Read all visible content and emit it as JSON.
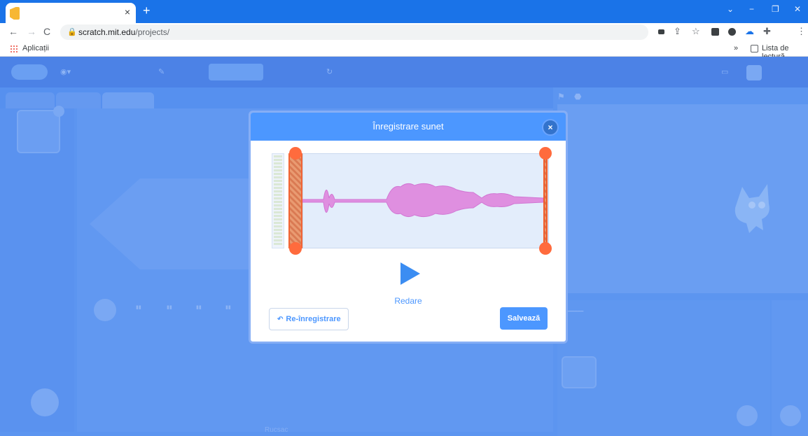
{
  "browser": {
    "tab_close": "×",
    "new_tab": "+",
    "window_controls": {
      "minimize": "−",
      "restore": "❐",
      "close": "✕",
      "chevron": "⌄"
    },
    "nav": {
      "back": "←",
      "forward": "→",
      "reload": "C"
    },
    "url_host": "scratch.mit.edu",
    "url_path": "/projects/",
    "bookmarks": {
      "apps_label": "Aplicații",
      "overflow": "»",
      "reading_list": "Lista de lectură"
    }
  },
  "modal": {
    "title": "Înregistrare sunet",
    "close_glyph": "×",
    "play_label": "Redare",
    "rerecord_label": "Re-înregistrare",
    "save_label": "Salvează"
  },
  "colors": {
    "modal_header": "#4c97ff",
    "waveform": "#df8fe0",
    "trim_handle": "#ff6b3d",
    "overlay": "#5c95f0"
  },
  "background": {
    "bottom_label": "Rucsac"
  }
}
